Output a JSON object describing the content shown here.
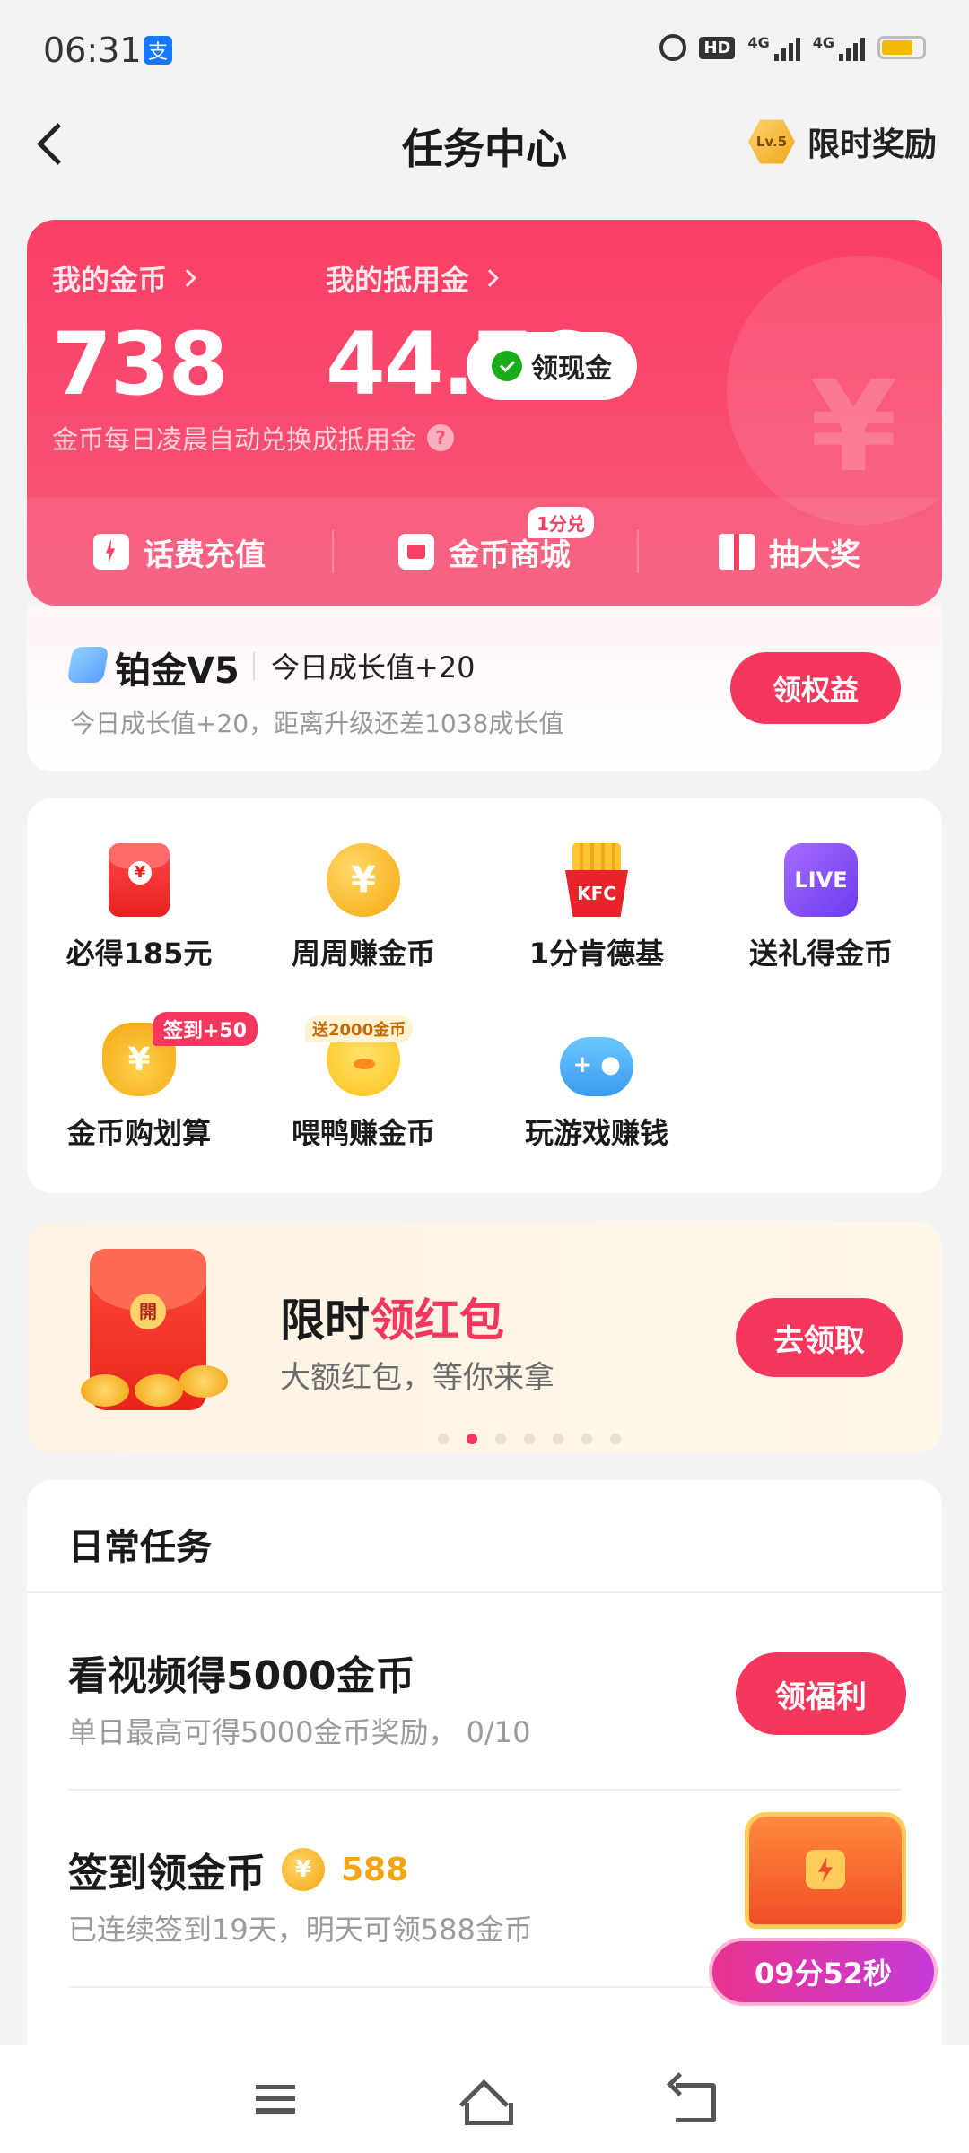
{
  "status_bar": {
    "time": "06:31",
    "app_icon_glyph": "支",
    "hd_label": "HD",
    "signal_label_1": "4G",
    "signal_label_2": "4G"
  },
  "header": {
    "title": "任务中心",
    "level_badge": "Lv.5",
    "reward_label": "限时奖励"
  },
  "coin_card": {
    "coins_label": "我的金币",
    "coins_value": "738",
    "deduct_label": "我的抵用金",
    "deduct_value": "44.76",
    "cash_button": "领现金",
    "hint": "金币每日凌晨自动兑换成抵用金",
    "actions": [
      {
        "label": "话费充值",
        "icon": "phone-recharge-icon"
      },
      {
        "label": "金币商城",
        "icon": "coin-mall-icon",
        "badge": "1分兑"
      },
      {
        "label": "抽大奖",
        "icon": "gift-icon"
      }
    ]
  },
  "vip": {
    "title": "铂金V5",
    "today": "今日成长值+20",
    "sub": "今日成长值+20，距离升级还差1038成长值",
    "button": "领权益"
  },
  "features": [
    {
      "label": "必得185元",
      "icon": "red-packet-icon"
    },
    {
      "label": "周周赚金币",
      "icon": "coin-icon",
      "glyph": "¥"
    },
    {
      "label": "1分肯德基",
      "icon": "kfc-icon"
    },
    {
      "label": "送礼得金币",
      "icon": "live-icon",
      "glyph": "LIVE"
    },
    {
      "label": "金币购划算",
      "icon": "money-bag-icon",
      "glyph": "¥",
      "badge": "签到+50"
    },
    {
      "label": "喂鸭赚金币",
      "icon": "duck-icon",
      "badge": "送2000金币"
    },
    {
      "label": "玩游戏赚钱",
      "icon": "gamepad-icon"
    }
  ],
  "banner": {
    "title_plain": "限时",
    "title_accent": "领红包",
    "sub": "大额红包，等你来拿",
    "button": "去领取",
    "dots_total": 7,
    "dots_active": 1
  },
  "tasks": {
    "header": "日常任务",
    "items": [
      {
        "title": "看视频得5000金币",
        "sub": "单日最高可得5000金币奖励，  0/10",
        "button": "领福利"
      },
      {
        "title": "签到领金币",
        "reward_glyph": "¥",
        "reward_amount": "588",
        "sub": "已连续签到19天，明天可领588金币"
      }
    ]
  },
  "chest": {
    "timer": "09分52秒"
  }
}
